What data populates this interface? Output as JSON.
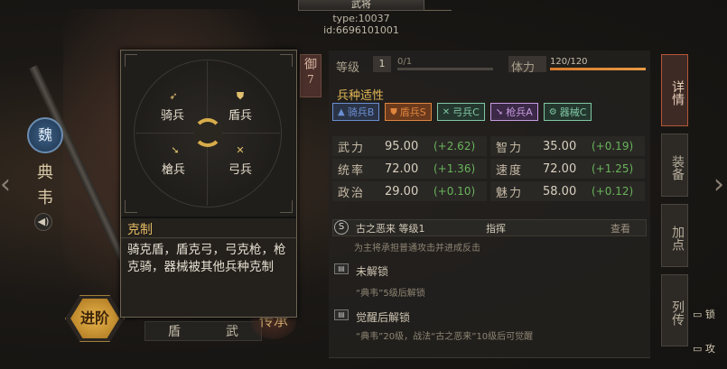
{
  "header": {
    "title": "武将",
    "type_line": "type:10037",
    "id_line": "id:6696101001"
  },
  "left": {
    "faction": "魏",
    "hero_name": "典韦",
    "speaker_icon": "speaker-icon",
    "advance_label": "进阶",
    "bottom_tabs": [
      "盾",
      "武"
    ],
    "inherit_label": "传承"
  },
  "ming": {
    "label": "御",
    "value": "7"
  },
  "popup": {
    "wheel": {
      "cavalry": "骑兵",
      "shield": "盾兵",
      "spear": "槍兵",
      "bow": "弓兵"
    },
    "title": "克制",
    "text": "骑克盾，盾克弓，弓克枪，枪克骑，器械被其他兵种克制"
  },
  "panel": {
    "level_label": "等级",
    "level_value": "1",
    "exp_text": "0/1",
    "stamina_label": "体力",
    "stamina_text": "120/120",
    "stamina_fraction": 1.0,
    "affinity_title": "兵种适性",
    "affinities": [
      {
        "label": "骑兵B",
        "color": "#6a8ed1",
        "bg": "#2b3447"
      },
      {
        "label": "盾兵S",
        "color": "#e0853e",
        "bg": "#6b3a1d"
      },
      {
        "label": "弓兵C",
        "color": "#7fc7a3",
        "bg": "#24372e"
      },
      {
        "label": "枪兵A",
        "color": "#c89be0",
        "bg": "#3b2947"
      },
      {
        "label": "器械C",
        "color": "#7fc7a3",
        "bg": "#24372e"
      }
    ],
    "attributes": [
      [
        {
          "name": "武力",
          "value": "95.00",
          "bonus": "(+2.62)"
        },
        {
          "name": "智力",
          "value": "35.00",
          "bonus": "(+0.19)"
        }
      ],
      [
        {
          "name": "统率",
          "value": "72.00",
          "bonus": "(+1.36)"
        },
        {
          "name": "速度",
          "value": "72.00",
          "bonus": "(+1.25)"
        }
      ],
      [
        {
          "name": "政治",
          "value": "29.00",
          "bonus": "(+0.10)"
        },
        {
          "name": "魅力",
          "value": "58.00",
          "bonus": "(+0.12)"
        }
      ]
    ],
    "skill": {
      "badge": "S",
      "name": "古之恶来 等级1",
      "type": "指挥",
      "view": "查看",
      "desc": "为主将承担普通攻击并进成反击"
    },
    "lock1": {
      "title": "未解锁",
      "desc": "“典韦”5级后解锁"
    },
    "lock2": {
      "title": "觉醒后解锁",
      "desc": "“典韦”20级，战法“古之恶来”10级后可觉醒"
    }
  },
  "right_tabs": {
    "detail": "详情",
    "equip": "装备",
    "add": "加点",
    "bio": "列传"
  },
  "right_edge": {
    "item1": "锁",
    "item2": "攻"
  }
}
